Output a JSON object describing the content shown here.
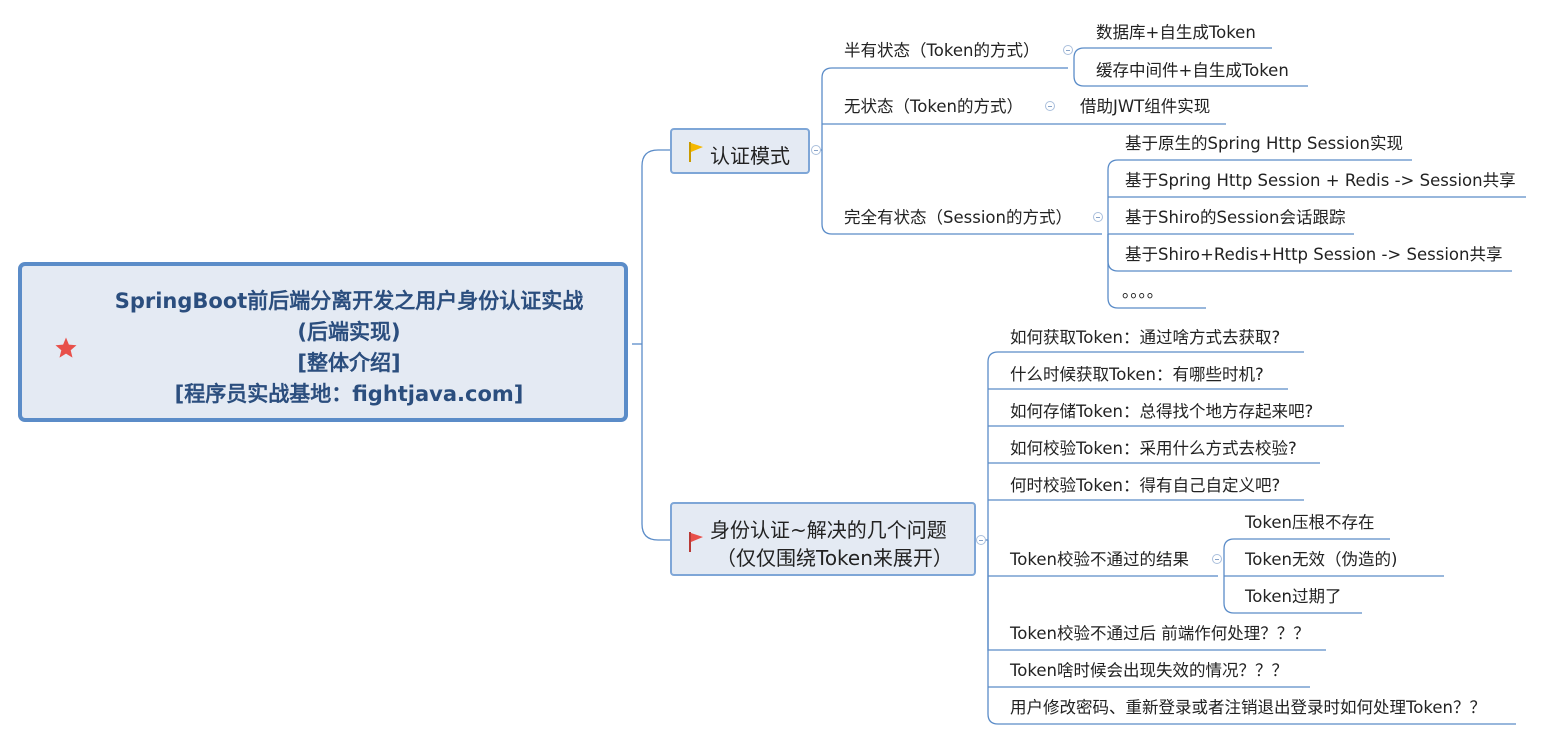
{
  "root": {
    "title_lines": [
      "SpringBoot前后端分离开发之用户身份认证实战",
      "(后端实现)",
      "[整体介绍]",
      "[程序员实战基地：fightjava.com]"
    ]
  },
  "colors": {
    "line": "#5b8cc8",
    "root_border": "#5b8cc8",
    "node_fill": "#e4eaf3",
    "flag_yellow": "#f5b800",
    "flag_red": "#e8504a",
    "star_red": "#e8504a"
  },
  "branches": {
    "auth_mode": {
      "label": "认证模式",
      "icon": "yellow-flag-icon",
      "children": {
        "semi": {
          "label": "半有状态（Token的方式）",
          "children": [
            "数据库+自生成Token",
            "缓存中间件+自生成Token"
          ]
        },
        "stateless": {
          "label": "无状态（Token的方式）",
          "children": [
            "借助JWT组件实现"
          ]
        },
        "stateful": {
          "label": "完全有状态（Session的方式）",
          "children": [
            "基于原生的Spring Http Session实现",
            "基于Spring Http Session + Redis -> Session共享",
            "基于Shiro的Session会话跟踪",
            "基于Shiro+Redis+Http Session -> Session共享",
            "。。。。"
          ]
        }
      }
    },
    "problems": {
      "label_lines": [
        "身份认证~解决的几个问题",
        "（仅仅围绕Token来展开）"
      ],
      "icon": "red-flag-icon",
      "items": [
        "如何获取Token：通过啥方式去获取?",
        "什么时候获取Token：有哪些时机?",
        "如何存储Token：总得找个地方存起来吧?",
        "如何校验Token：采用什么方式去校验?",
        "何时校验Token：得有自己自定义吧?",
        "Token校验不通过的结果",
        "Token校验不通过后 前端作何处理？？？",
        "Token啥时候会出现失效的情况？？？",
        "用户修改密码、重新登录或者注销退出登录时如何处理Token？？"
      ],
      "fail_results": [
        "Token压根不存在",
        "Token无效（伪造的)",
        "Token过期了"
      ]
    }
  }
}
